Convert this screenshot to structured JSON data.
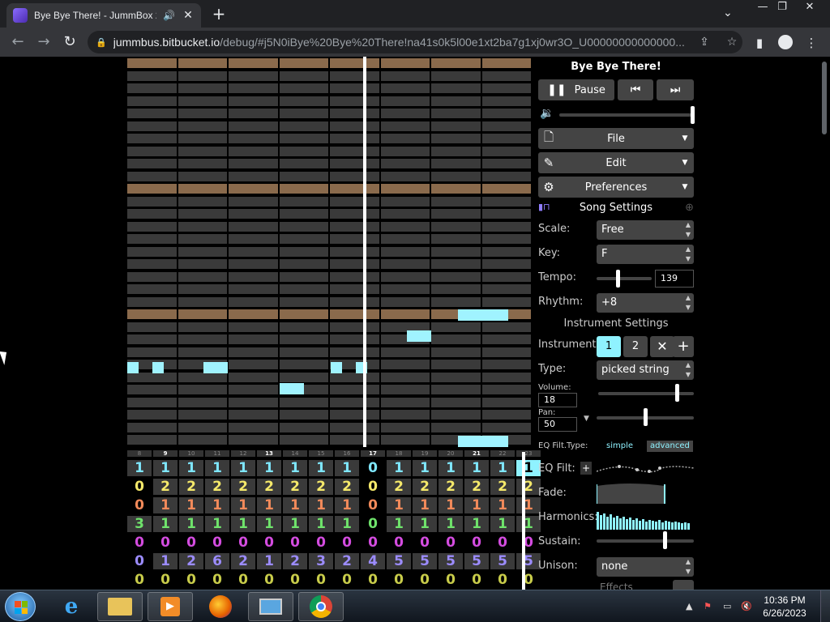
{
  "browser": {
    "tab_title": "Bye Bye There! - JummBox 2.",
    "tab_audio_icon": "speaker-icon",
    "url_host": "jummbus.bitbucket.io",
    "url_path": "/debug/#j5N0iBye%20Bye%20There!na41s0k5l00e1xt2ba7g1xj0wr3O_U00000000000000..."
  },
  "song": {
    "title": "Bye Bye There!",
    "pause_label": "Pause",
    "file_label": "File",
    "edit_label": "Edit",
    "preferences_label": "Preferences",
    "volume_level": 1.0,
    "song_settings_label": "Song Settings",
    "scale_label": "Scale:",
    "scale_value": "Free",
    "key_label": "Key:",
    "key_value": "F",
    "tempo_label": "Tempo:",
    "tempo_value": "139",
    "tempo_level": 0.38,
    "rhythm_label": "Rhythm:",
    "rhythm_value": "+8"
  },
  "instrument": {
    "section_label": "Instrument Settings",
    "instrument_label": "Instrument:",
    "btn1": "1",
    "btn2": "2",
    "type_label": "Type:",
    "type_value": "picked string",
    "volume_label": "Volume:",
    "volume_value": "18",
    "volume_level": 0.82,
    "pan_label": "Pan:",
    "pan_value": "50",
    "pan_level": 0.5,
    "eq_type_label": "EQ Filt.Type:",
    "eq_simple": "simple",
    "eq_advanced": "advanced",
    "eq_filt_label": "EQ Filt:",
    "fade_label": "Fade:",
    "harmonics_label": "Harmonics:",
    "sustain_label": "Sustain:",
    "sustain_level": 0.7,
    "unison_label": "Unison:",
    "unison_value": "none",
    "effects_label": "Effects"
  },
  "tracker": {
    "bar_numbers": [
      "8",
      "9",
      "10",
      "11",
      "12",
      "13",
      "14",
      "15",
      "16",
      "17",
      "18",
      "19",
      "20",
      "21",
      "22",
      "23"
    ],
    "strong_bars": [
      "9",
      "13",
      "17",
      "21"
    ],
    "rows": [
      {
        "color": "#7fe7ff",
        "cells": [
          "1",
          "1",
          "1",
          "1",
          "1",
          "1",
          "1",
          "1",
          "1",
          "0",
          "1",
          "1",
          "1",
          "1",
          "1",
          "1"
        ]
      },
      {
        "color": "#f5e96a",
        "cells": [
          "0",
          "2",
          "2",
          "2",
          "2",
          "2",
          "2",
          "2",
          "2",
          "0",
          "2",
          "2",
          "2",
          "2",
          "2",
          "2"
        ]
      },
      {
        "color": "#f28a5a",
        "cells": [
          "0",
          "1",
          "1",
          "1",
          "1",
          "1",
          "1",
          "1",
          "1",
          "0",
          "1",
          "1",
          "1",
          "1",
          "1",
          "1"
        ]
      },
      {
        "color": "#6fe36b",
        "cells": [
          "3",
          "1",
          "1",
          "1",
          "1",
          "1",
          "1",
          "1",
          "1",
          "0",
          "1",
          "1",
          "1",
          "1",
          "1",
          "1"
        ]
      },
      {
        "color": "#d44ce0",
        "cells": [
          "0",
          "0",
          "0",
          "0",
          "0",
          "0",
          "0",
          "0",
          "0",
          "0",
          "0",
          "0",
          "0",
          "0",
          "0",
          "0"
        ]
      },
      {
        "color": "#9c8cff",
        "cells": [
          "0",
          "1",
          "2",
          "6",
          "2",
          "1",
          "2",
          "3",
          "2",
          "4",
          "5",
          "5",
          "5",
          "5",
          "5",
          "5"
        ]
      },
      {
        "color": "#c8cc4a",
        "cells": [
          "0",
          "0",
          "0",
          "0",
          "0",
          "0",
          "0",
          "0",
          "0",
          "0",
          "0",
          "0",
          "0",
          "0",
          "0",
          "0"
        ]
      }
    ]
  },
  "taskbar": {
    "time": "10:36 PM",
    "date": "6/26/2023"
  }
}
